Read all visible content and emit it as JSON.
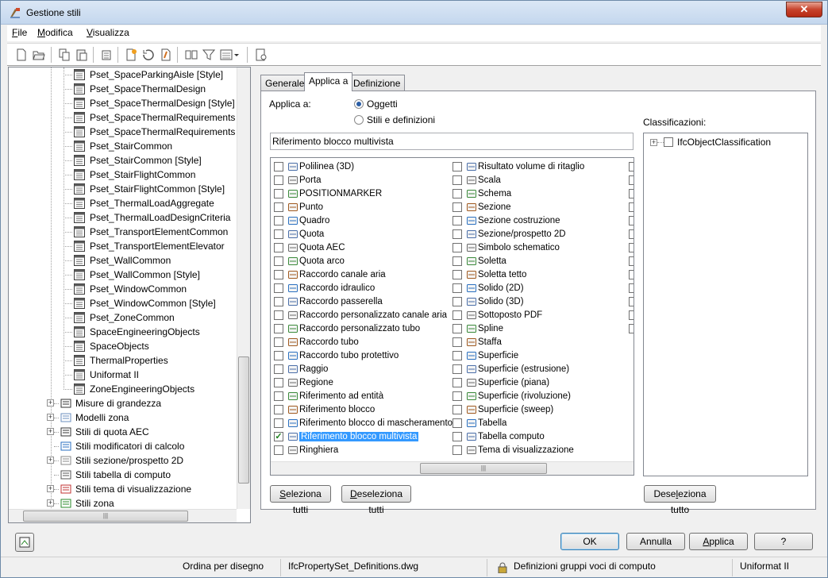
{
  "window": {
    "title": "Gestione stili",
    "close_label": "✕"
  },
  "menu": {
    "file": "File",
    "file_u": "F",
    "file_rest": "ile",
    "modifica_u": "M",
    "modifica_rest": "odifica",
    "visualizza_u": "V",
    "visualizza_rest": "isualizza"
  },
  "toolbar": {
    "icons": [
      "new-icon",
      "open-icon",
      "copy-icon",
      "paste-icon",
      "purge-icon",
      "new-style-icon",
      "edit-style-icon",
      "set-from-icon",
      "toggle-view-icon",
      "filter-icon",
      "view-options-icon",
      "inventory-icon"
    ]
  },
  "tree": {
    "children": [
      "Pset_SpaceParkingAisle [Style]",
      "Pset_SpaceThermalDesign",
      "Pset_SpaceThermalDesign [Style]",
      "Pset_SpaceThermalRequirements",
      "Pset_SpaceThermalRequirements [S",
      "Pset_StairCommon",
      "Pset_StairCommon [Style]",
      "Pset_StairFlightCommon",
      "Pset_StairFlightCommon [Style]",
      "Pset_ThermalLoadAggregate",
      "Pset_ThermalLoadDesignCriteria",
      "Pset_TransportElementCommon",
      "Pset_TransportElementElevator",
      "Pset_WallCommon",
      "Pset_WallCommon [Style]",
      "Pset_WindowCommon",
      "Pset_WindowCommon [Style]",
      "Pset_ZoneCommon",
      "SpaceEngineeringObjects",
      "SpaceObjects",
      "ThermalProperties",
      "Uniformat II",
      "ZoneEngineeringObjects"
    ],
    "roots": [
      "Misure di grandezza",
      "Modelli zona",
      "Stili di quota AEC",
      "Stili modificatori di calcolo",
      "Stili sezione/prospetto 2D",
      "Stili tabella di computo",
      "Stili tema di visualizzazione",
      "Stili zona"
    ]
  },
  "tabs": [
    "Generale",
    "Applica a",
    "Definizione"
  ],
  "applica": {
    "label": "Applica a:",
    "opt1": "Oggetti",
    "opt2": "Stili e definizioni",
    "selected": "Oggetti",
    "filter_value": "Riferimento blocco multivista",
    "classificazioni_label": "Classificazioni:",
    "class_item": "IfcObjectClassification"
  },
  "objects_col1": [
    {
      "label": "Polilinea (3D)",
      "checked": false
    },
    {
      "label": "Porta",
      "checked": false
    },
    {
      "label": "POSITIONMARKER",
      "checked": false
    },
    {
      "label": "Punto",
      "checked": false
    },
    {
      "label": "Quadro",
      "checked": false
    },
    {
      "label": "Quota",
      "checked": false
    },
    {
      "label": "Quota AEC",
      "checked": false
    },
    {
      "label": "Quota arco",
      "checked": false
    },
    {
      "label": "Raccordo canale aria",
      "checked": false
    },
    {
      "label": "Raccordo idraulico",
      "checked": false
    },
    {
      "label": "Raccordo passerella",
      "checked": false
    },
    {
      "label": "Raccordo personalizzato canale aria",
      "checked": false
    },
    {
      "label": "Raccordo personalizzato tubo",
      "checked": false
    },
    {
      "label": "Raccordo tubo",
      "checked": false
    },
    {
      "label": "Raccordo tubo protettivo",
      "checked": false
    },
    {
      "label": "Raggio",
      "checked": false
    },
    {
      "label": "Regione",
      "checked": false
    },
    {
      "label": "Riferimento ad entità",
      "checked": false
    },
    {
      "label": "Riferimento blocco",
      "checked": false
    },
    {
      "label": "Riferimento blocco di mascheramento",
      "checked": false
    },
    {
      "label": "Riferimento blocco multivista",
      "checked": true
    },
    {
      "label": "Ringhiera",
      "checked": false
    }
  ],
  "objects_col2": [
    {
      "label": "Risultato volume di ritaglio",
      "checked": false
    },
    {
      "label": "Scala",
      "checked": false
    },
    {
      "label": "Schema",
      "checked": false
    },
    {
      "label": "Sezione",
      "checked": false
    },
    {
      "label": "Sezione costruzione",
      "checked": false
    },
    {
      "label": "Sezione/prospetto 2D",
      "checked": false
    },
    {
      "label": "Simbolo schematico",
      "checked": false
    },
    {
      "label": "Soletta",
      "checked": false
    },
    {
      "label": "Soletta tetto",
      "checked": false
    },
    {
      "label": "Solido (2D)",
      "checked": false
    },
    {
      "label": "Solido (3D)",
      "checked": false
    },
    {
      "label": "Sottoposto PDF",
      "checked": false
    },
    {
      "label": "Spline",
      "checked": false
    },
    {
      "label": "Staffa",
      "checked": false
    },
    {
      "label": "Superficie",
      "checked": false
    },
    {
      "label": "Superficie (estrusione)",
      "checked": false
    },
    {
      "label": "Superficie (piana)",
      "checked": false
    },
    {
      "label": "Superficie (rivoluzione)",
      "checked": false
    },
    {
      "label": "Superficie (sweep)",
      "checked": false
    },
    {
      "label": "Tabella",
      "checked": false
    },
    {
      "label": "Tabella computo",
      "checked": false
    },
    {
      "label": "Tema di visualizzazione",
      "checked": false
    }
  ],
  "buttons": {
    "seleziona_tutti": "Seleziona tutti",
    "deseleziona_tutti": "Deseleziona tutti",
    "deseleziona_tutto": "Deseleziona tutto",
    "ok": "OK",
    "annulla": "Annulla",
    "applica": "Applica",
    "help": "?"
  },
  "status": {
    "ordina": "Ordina per disegno",
    "file": "IfcPropertySet_Definitions.dwg",
    "definizioni": "Definizioni gruppi voci di computo",
    "uniformat": "Uniformat II"
  },
  "colors": {
    "accent": "#3399ff",
    "check": "#1a7f1a"
  }
}
